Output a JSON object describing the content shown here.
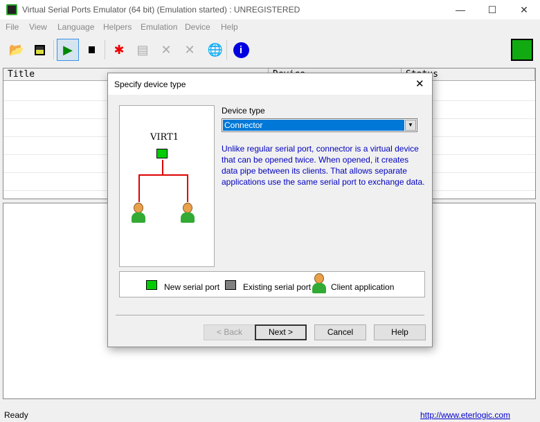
{
  "window": {
    "title": "Virtual Serial Ports Emulator (64 bit) (Emulation started) : UNREGISTERED",
    "minimize": "—",
    "maximize": "☐",
    "close": "✕"
  },
  "menu": [
    "File",
    "View",
    "Language",
    "Helpers",
    "Emulation",
    "Device",
    "Help"
  ],
  "toolbar": {
    "icons": [
      "open-icon",
      "save-icon",
      "start-icon",
      "stop-icon",
      "new-device-icon",
      "device-properties-icon",
      "delete-device-icon",
      "delete-all-icon",
      "network-icon",
      "info-icon"
    ]
  },
  "list": {
    "columns": [
      "Title",
      "Device",
      "Status"
    ]
  },
  "status": {
    "text": "Ready",
    "link": "http://www.eterlogic.com"
  },
  "dialog": {
    "title": "Specify device type",
    "device_type_label": "Device type",
    "device_type_value": "Connector",
    "description": "Unlike regular serial port, connector is a virtual device that can be opened twice. When opened, it creates data pipe between its clients. That allows separate applications use the same serial port to exchange data.",
    "diagram_label": "VIRT1",
    "legend": {
      "new": "New serial port",
      "existing": "Existing serial port",
      "client": "Client application"
    },
    "buttons": {
      "back": "< Back",
      "next": "Next >",
      "cancel": "Cancel",
      "help": "Help"
    },
    "colors": {
      "description": "#0000c0",
      "new_port": "#00cc00",
      "existing_port": "#808080",
      "wire": "#dd0000"
    }
  }
}
